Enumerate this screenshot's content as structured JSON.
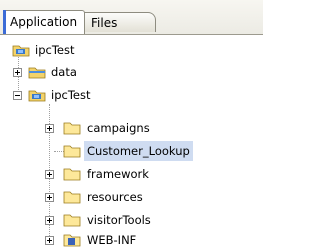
{
  "tabs": [
    {
      "label": "Application",
      "active": true
    },
    {
      "label": "Files",
      "active": false
    }
  ],
  "tree": {
    "root": {
      "label": "ipcTest",
      "icon": "project-folder-icon"
    },
    "children": [
      {
        "label": "data",
        "expanded": false,
        "icon": "folder-icon"
      },
      {
        "label": "ipcTest",
        "expanded": true,
        "icon": "project-folder-icon",
        "children": [
          {
            "label": "campaigns",
            "expanded": false,
            "icon": "folder-icon"
          },
          {
            "label": "Customer_Lookup",
            "selected": true,
            "icon": "folder-icon"
          },
          {
            "label": "framework",
            "expanded": false,
            "icon": "folder-icon"
          },
          {
            "label": "resources",
            "expanded": false,
            "icon": "folder-icon"
          },
          {
            "label": "visitorTools",
            "expanded": false,
            "icon": "folder-icon"
          },
          {
            "label": "WEB-INF",
            "expanded": false,
            "icon": "web-inf-folder-icon"
          }
        ]
      }
    ]
  },
  "colors": {
    "selection": "#cfdcf1",
    "folder": "#f3d36b",
    "tab_accent": "#3b6bd6"
  }
}
